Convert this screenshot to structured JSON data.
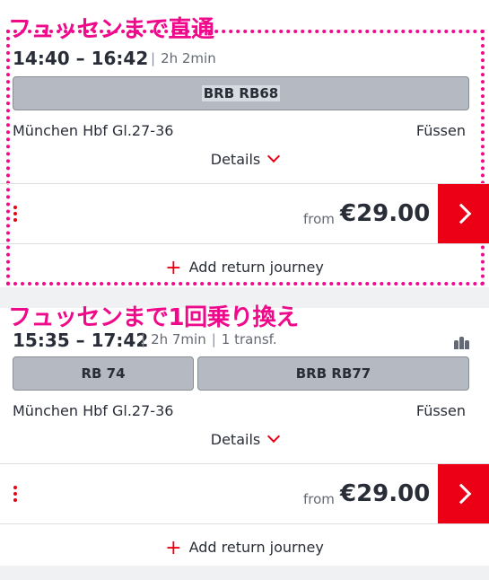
{
  "connection1": {
    "annotation": "フュッセンまで直通",
    "times": "14:40 – 16:42",
    "duration": "2h 2min",
    "train": "BRB RB68",
    "from_station": "München Hbf Gl.27-36",
    "to_station": "Füssen",
    "details_label": "Details",
    "from_label": "from",
    "price": "€29.00",
    "return_label": "Add return journey"
  },
  "connection2": {
    "annotation": "フュッセンまで1回乗り換え",
    "times": "15:35 – 17:42",
    "duration": "2h 7min",
    "transfers": "1 transf.",
    "trains": [
      "RB 74",
      "BRB RB77"
    ],
    "from_station": "München Hbf Gl.27-36",
    "to_station": "Füssen",
    "details_label": "Details",
    "from_label": "from",
    "price": "€29.00",
    "return_label": "Add return journey"
  },
  "colors": {
    "accent": "#ec0016",
    "annotation": "#ee0a8b",
    "train_pill": "#b4b9c2"
  }
}
